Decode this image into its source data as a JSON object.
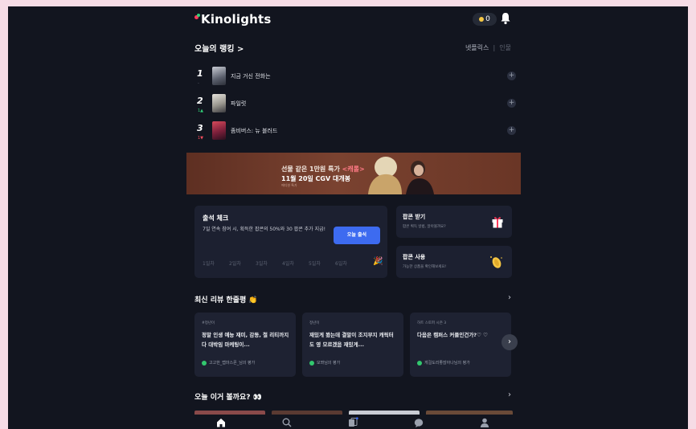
{
  "header": {
    "logo_text": "Kinolights",
    "popcorn_count": "0",
    "icons": [
      "popcorn-icon",
      "bell-icon"
    ]
  },
  "ranking": {
    "title": "오늘의 랭킹 >",
    "source_active": "넷플릭스",
    "source_inactive": "인물",
    "items": [
      {
        "rank": "1",
        "delta": "-",
        "title": "지금 거신 전화는"
      },
      {
        "rank": "2",
        "delta": "1▲",
        "title": "파일럿"
      },
      {
        "rank": "3",
        "delta": "1▼",
        "title": "좀비버스: 뉴 블러드"
      }
    ]
  },
  "banner": {
    "line1_prefix": "선물 같은 1만원 특가 ",
    "line1_highlight": "<캐롤>",
    "line2": "11월 20일 CGV 대개봉",
    "line3": "에디션 특가"
  },
  "attendance": {
    "title": "출석 체크",
    "desc": "7일 연속 참여 시, 획득한 팝콘의 50%와 30 팝콘 추가 지급!",
    "button": "오늘 출석",
    "days": [
      "1일차",
      "2일차",
      "3일차",
      "4일차",
      "5일차",
      "6일차"
    ]
  },
  "popcorn_get": {
    "title": "팝콘 받기",
    "sub": "팝콘 획득 방법, 알아볼까요?"
  },
  "popcorn_use": {
    "title": "팝콘 사용",
    "sub": "가능한 상품을 확인해보세요!"
  },
  "reviews": {
    "title": "최신 리뷰 한줄평 👏",
    "items": [
      {
        "tag": "#정년이",
        "text": "정말 인생 예능 재미, 감동, 철 리티까지 다 대박임 마케팅이...",
        "by": "고고한_랩마스몬_님의 평가"
      },
      {
        "tag": "정년이",
        "text": "재밌게 봤는데 결말이 조지부지 캐릭터도 영 모르겠음 재밌게...",
        "by": "모뫄님의 평가"
      },
      {
        "tag": "하트 스토퍼 시즌 3",
        "text": "다음은 캠퍼스 커플인건가?♡ ♡",
        "by": "게걸도리좋잖아나님의 평가"
      }
    ]
  },
  "today": {
    "title": "오늘 이거 볼까요? 👀"
  },
  "colors": {
    "background": "#12151f",
    "accent_blue": "#3d6bf0",
    "logo_red": "#ff3b5c",
    "rank_up": "#32d17a",
    "rank_down": "#ff4d5e"
  },
  "bottom_nav": [
    "home-icon",
    "search-icon",
    "community-icon",
    "chat-icon",
    "profile-icon"
  ]
}
